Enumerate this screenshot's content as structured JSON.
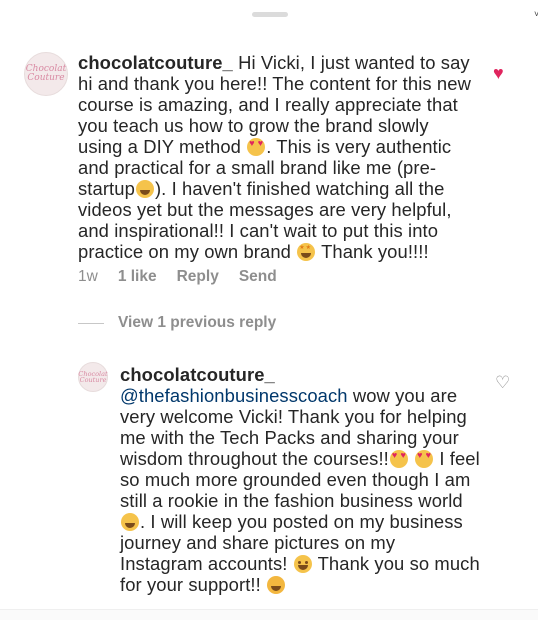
{
  "comments": [
    {
      "avatar_text": "Chocolat Couture",
      "username": "chocolatcouture_",
      "segments": [
        {
          "type": "text",
          "value": " Hi Vicki, I just wanted to say hi and thank you here!! The content for this new course is amazing, and I really appreciate that you teach us how to grow the brand slowly using a DIY method "
        },
        {
          "type": "emoji",
          "value": "smiling-face-with-heart-eyes"
        },
        {
          "type": "text",
          "value": ". This is very authentic and practical for a small brand like me (pre-startup"
        },
        {
          "type": "emoji",
          "value": "grinning-face"
        },
        {
          "type": "text",
          "value": "). I haven't finished watching all the videos yet but the messages are very helpful, and inspirational!! I can't wait to put this into practice on my own brand "
        },
        {
          "type": "emoji",
          "value": "star-struck"
        },
        {
          "type": "text",
          "value": " Thank you!!!!"
        }
      ],
      "meta": {
        "time": "1w",
        "likes": "1 like",
        "reply": "Reply",
        "send": "Send"
      },
      "like_icon": "heart-filled-icon"
    },
    {
      "avatar_text": "Chocolat Couture",
      "username": "chocolatcouture_",
      "mention": "@thefashionbusinesscoach",
      "segments": [
        {
          "type": "text",
          "value": " wow you are very welcome Vicki! Thank you for helping me with the Tech Packs and sharing your wisdom throughout the courses!!"
        },
        {
          "type": "emoji",
          "value": "smiling-face-with-heart-eyes"
        },
        {
          "type": "emoji",
          "value": "smiling-face-with-heart-eyes"
        },
        {
          "type": "text",
          "value": " I feel so much more grounded even though I am still a rookie in the fashion business world "
        },
        {
          "type": "emoji",
          "value": "grinning-face"
        },
        {
          "type": "text",
          "value": ". I will keep you posted on my business journey and share pictures on my Instagram accounts! "
        },
        {
          "type": "emoji",
          "value": "smiling-face"
        },
        {
          "type": "text",
          "value": " Thank you so much for your support!! "
        },
        {
          "type": "emoji",
          "value": "hugging-face"
        }
      ],
      "like_icon": "heart-outline-icon"
    }
  ],
  "view_previous": "View 1 previous reply",
  "colors": {
    "text": "#262626",
    "muted": "#8e8e8e",
    "mention": "#00376b",
    "heart": "#e0245e"
  }
}
